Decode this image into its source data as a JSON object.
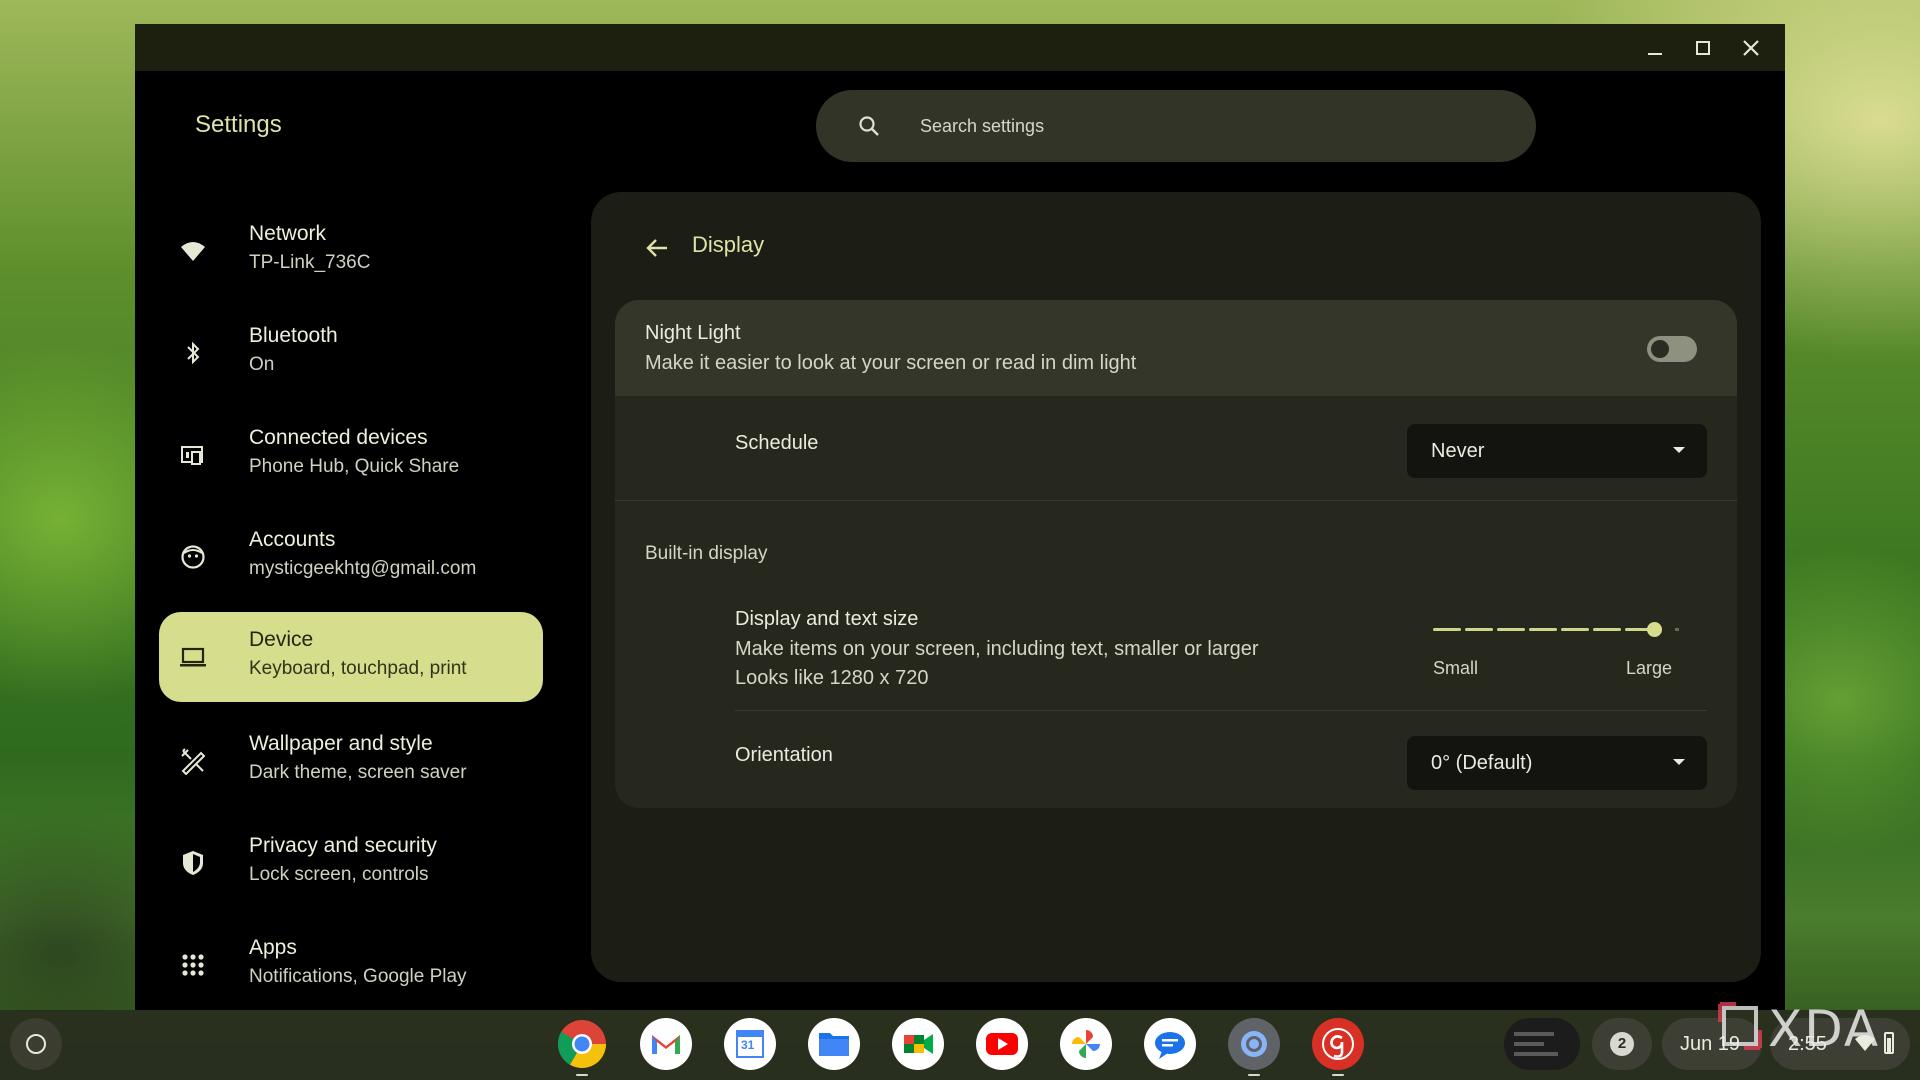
{
  "window": {
    "controls": {
      "minimize": "minimize",
      "maximize": "maximize",
      "close": "close"
    }
  },
  "app": {
    "title": "Settings",
    "search": {
      "placeholder": "Search settings"
    }
  },
  "sidebar": {
    "items": [
      {
        "title": "Network",
        "subtitle": "TP-Link_736C",
        "icon": "wifi-icon"
      },
      {
        "title": "Bluetooth",
        "subtitle": "On",
        "icon": "bluetooth-icon"
      },
      {
        "title": "Connected devices",
        "subtitle": "Phone Hub, Quick Share",
        "icon": "connected-devices-icon"
      },
      {
        "title": "Accounts",
        "subtitle": "mysticgeekhtg@gmail.com",
        "icon": "account-face-icon"
      },
      {
        "title": "Device",
        "subtitle": "Keyboard, touchpad, print",
        "icon": "laptop-icon",
        "active": true
      },
      {
        "title": "Wallpaper and style",
        "subtitle": "Dark theme, screen saver",
        "icon": "palette-brush-icon"
      },
      {
        "title": "Privacy and security",
        "subtitle": "Lock screen, controls",
        "icon": "shield-icon"
      },
      {
        "title": "Apps",
        "subtitle": "Notifications, Google Play",
        "icon": "apps-grid-icon"
      }
    ]
  },
  "display": {
    "title": "Display",
    "night_light": {
      "title": "Night Light",
      "description": "Make it easier to look at your screen or read in dim light",
      "enabled": false
    },
    "schedule": {
      "label": "Schedule",
      "value": "Never"
    },
    "builtin_section": "Built-in display",
    "text_size": {
      "title": "Display and text size",
      "description": "Make items on your screen, including text, smaller or larger",
      "resolution": "Looks like 1280 x 720",
      "min_label": "Small",
      "max_label": "Large",
      "steps": 8,
      "selected_step": 7
    },
    "orientation": {
      "label": "Orientation",
      "value": "0° (Default)"
    }
  },
  "shelf": {
    "apps": [
      "chrome-icon",
      "gmail-icon",
      "calendar-icon",
      "files-icon",
      "meet-icon",
      "youtube-icon",
      "photos-icon",
      "messages-icon",
      "settings-icon",
      "g-app-icon"
    ],
    "calendar_day": "31",
    "notification_count": "2",
    "date": "Jun 19",
    "time": "2:55"
  },
  "watermark": {
    "text": "XDA"
  },
  "colors": {
    "accent": "#d6de8e",
    "panel": "#1c1d15",
    "card": "#26271d"
  }
}
